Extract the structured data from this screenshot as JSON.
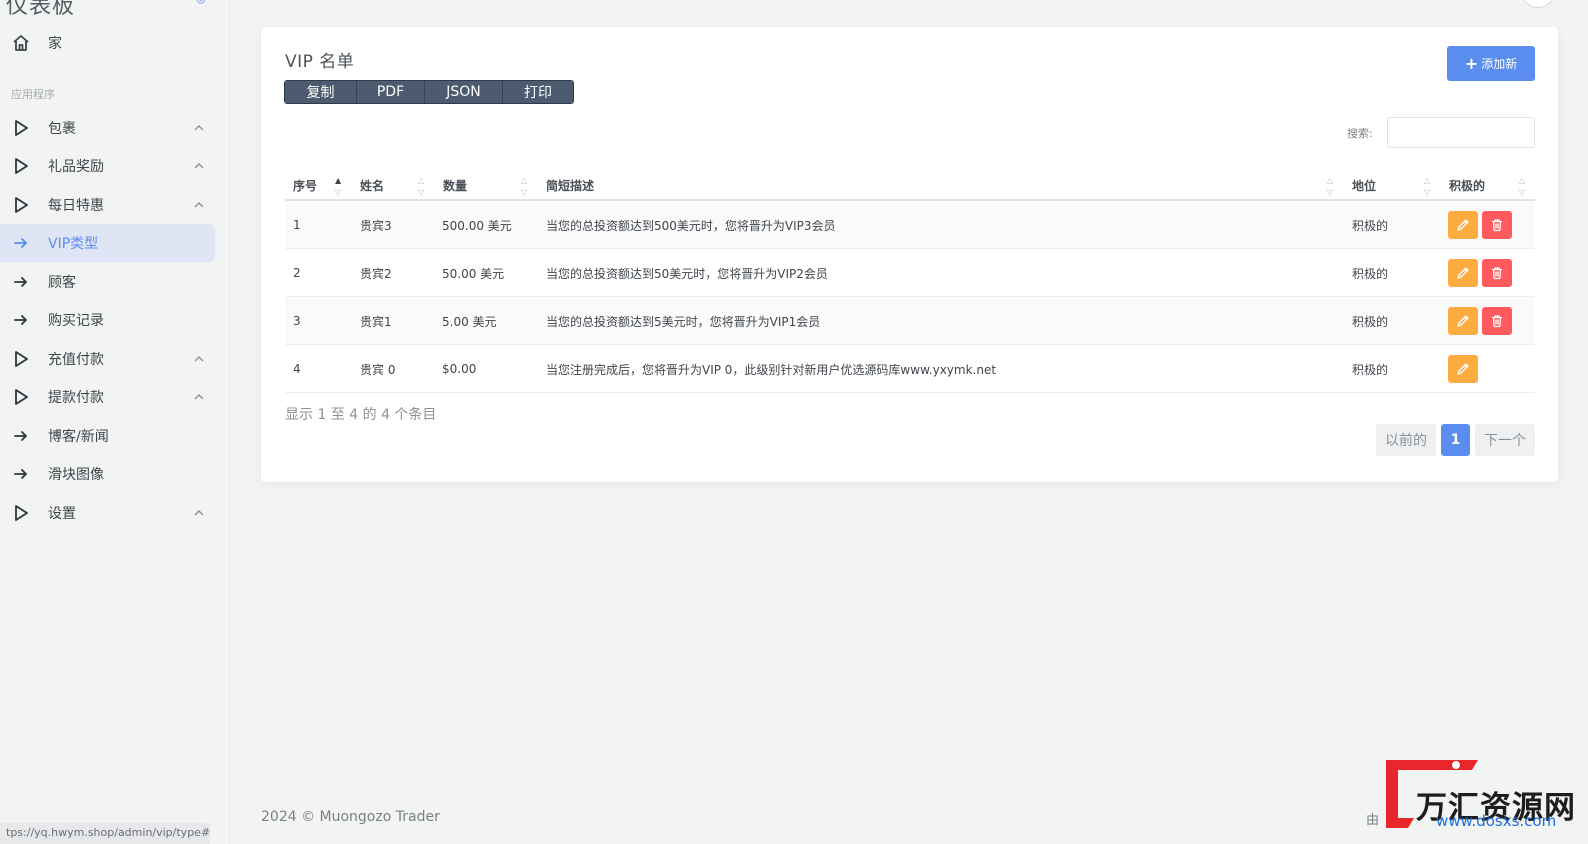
{
  "sidebar": {
    "brand": "仪表板",
    "home": "家",
    "section": "应用程序",
    "items": [
      {
        "label": "包裹",
        "icon": "play-outline-icon",
        "caret": true
      },
      {
        "label": "礼品奖励",
        "icon": "play-outline-icon",
        "caret": true
      },
      {
        "label": "每日特惠",
        "icon": "play-outline-icon",
        "caret": true
      },
      {
        "label": "VIP类型",
        "icon": "arrow-right-icon",
        "caret": false,
        "active": true
      },
      {
        "label": "顾客",
        "icon": "arrow-right-icon",
        "caret": false
      },
      {
        "label": "购买记录",
        "icon": "arrow-right-icon",
        "caret": false
      },
      {
        "label": "充值付款",
        "icon": "play-outline-icon",
        "caret": true
      },
      {
        "label": "提款付款",
        "icon": "play-outline-icon",
        "caret": true
      },
      {
        "label": "博客/新闻",
        "icon": "arrow-right-icon",
        "caret": false
      },
      {
        "label": "滑块图像",
        "icon": "arrow-right-icon",
        "caret": false
      },
      {
        "label": "设置",
        "icon": "play-outline-icon",
        "caret": true
      }
    ]
  },
  "card": {
    "title": "VIP 名单",
    "export_buttons": [
      "复制",
      "PDF",
      "JSON",
      "打印"
    ],
    "add_button": "添加新",
    "search_label": "搜索:",
    "search_value": ""
  },
  "table": {
    "headers": [
      "序号",
      "姓名",
      "数量",
      "简短描述",
      "地位",
      "积极的"
    ],
    "rows": [
      {
        "no": "1",
        "name": "贵宾3",
        "amount": "500.00 美元",
        "desc": "当您的总投资额达到500美元时，您将晋升为VIP3会员",
        "status": "积极的",
        "deletable": true
      },
      {
        "no": "2",
        "name": "贵宾2",
        "amount": "50.00 美元",
        "desc": "当您的总投资额达到50美元时，您将晋升为VIP2会员",
        "status": "积极的",
        "deletable": true
      },
      {
        "no": "3",
        "name": "贵宾1",
        "amount": "5.00 美元",
        "desc": "当您的总投资额达到5美元时，您将晋升为VIP1会员",
        "status": "积极的",
        "deletable": true
      },
      {
        "no": "4",
        "name": "贵宾 0",
        "amount": "$0.00",
        "desc": "当您注册完成后，您将晋升为VIP 0，此级别针对新用户优选源码库www.yxymk.net",
        "status": "积极的",
        "deletable": false
      }
    ]
  },
  "pagination": {
    "info": "显示 1 至 4 的 4 个条目",
    "prev": "以前的",
    "current": "1",
    "next": "下一个"
  },
  "footer": {
    "copyright": "2024 © Muongozo Trader",
    "right": "由",
    "status_url": "tps://yq.hwym.shop/admin/vip/type#"
  },
  "watermark": {
    "text": "万汇资源网",
    "url": "www.dosxs.com"
  },
  "colors": {
    "primary": "#5a8dee",
    "warning": "#fdac41",
    "danger": "#ff5b5c",
    "export_btn": "#4c5b6f"
  }
}
